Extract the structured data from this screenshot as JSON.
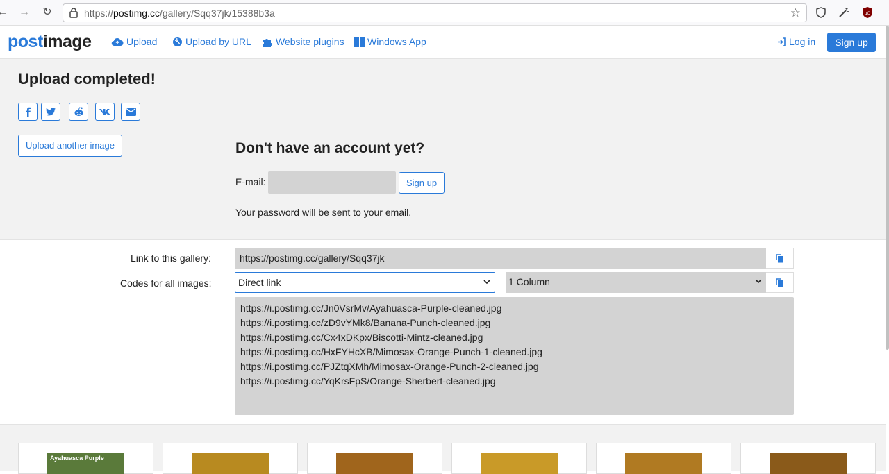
{
  "browser": {
    "url_prefix": "https://",
    "url_host": "postimg.cc",
    "url_path": "/gallery/Sqq37jk/15388b3a"
  },
  "header": {
    "logo_post": "post",
    "logo_image": "image",
    "nav": [
      {
        "label": "Upload"
      },
      {
        "label": "Upload by URL"
      },
      {
        "label": "Website plugins"
      },
      {
        "label": "Windows App"
      }
    ],
    "login_label": "Log in",
    "signup_label": "Sign up"
  },
  "upper": {
    "title": "Upload completed!",
    "share_icons": [
      "facebook-icon",
      "twitter-icon",
      "reddit-icon",
      "vk-icon",
      "email-icon"
    ],
    "upload_another_label": "Upload another image",
    "account_title": "Don't have an account yet?",
    "email_label": "E-mail:",
    "email_value": "",
    "signup_button_label": "Sign up",
    "password_note": "Your password will be sent to your email."
  },
  "links": {
    "gallery_label": "Link to this gallery:",
    "gallery_url": "https://postimg.cc/gallery/Sqq37jk",
    "codes_label": "Codes for all images:",
    "code_type_selected": "Direct link",
    "columns_selected": "1 Column",
    "codes": [
      "https://i.postimg.cc/Jn0VsrMv/Ayahuasca-Purple-cleaned.jpg",
      "https://i.postimg.cc/zD9vYMk8/Banana-Punch-cleaned.jpg",
      "https://i.postimg.cc/Cx4xDKpx/Biscotti-Mintz-cleaned.jpg",
      "https://i.postimg.cc/HxFYHcXB/Mimosax-Orange-Punch-1-cleaned.jpg",
      "https://i.postimg.cc/PJZtqXMh/Mimosax-Orange-Punch-2-cleaned.jpg",
      "https://i.postimg.cc/YqKrsFpS/Orange-Sherbert-cleaned.jpg"
    ]
  },
  "thumbnails": [
    {
      "caption": "Ayahuasca Purple",
      "color": "#5a7a3a"
    },
    {
      "caption": "",
      "color": "#b88a20"
    },
    {
      "caption": "",
      "color": "#a0651c"
    },
    {
      "caption": "",
      "color": "#c99a28"
    },
    {
      "caption": "",
      "color": "#b07a22"
    },
    {
      "caption": "",
      "color": "#8a5a1a"
    }
  ],
  "colors": {
    "accent": "#2a7ad9",
    "grey_bg": "#f2f2f2",
    "field_bg": "#d3d3d3"
  }
}
